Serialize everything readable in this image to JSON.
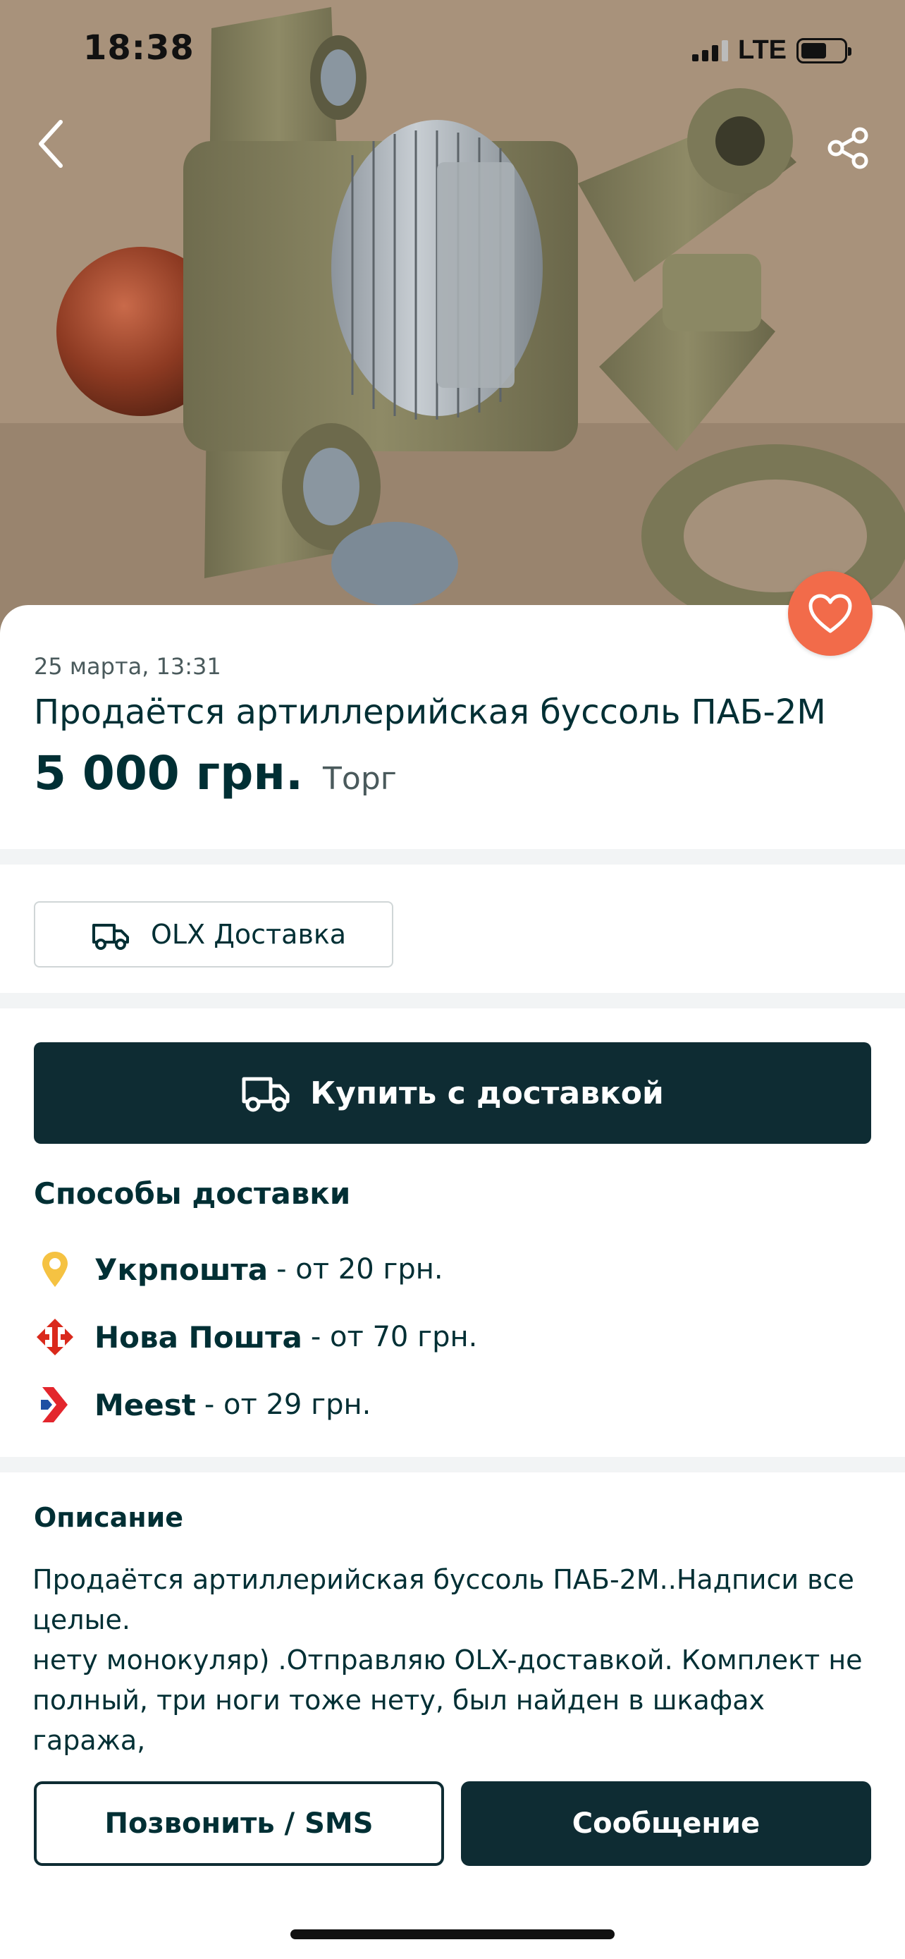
{
  "status_bar": {
    "time": "18:38",
    "network": "LTE",
    "battery_percent": 75
  },
  "nav": {
    "back_icon": "chevron-left-icon",
    "share_icon": "share-icon",
    "favorite_icon": "heart-icon"
  },
  "listing": {
    "date": "25 марта, 13:31",
    "title": "Продаётся артиллерийская буссоль ПАБ-2М",
    "price": "5 000 грн.",
    "negotiable": "Торг"
  },
  "olx_delivery": {
    "label": "OLX Доставка",
    "icon": "truck-icon"
  },
  "buy_button": {
    "label": "Купить с доставкой",
    "icon": "truck-icon"
  },
  "delivery": {
    "title": "Способы доставки",
    "items": [
      {
        "name": "Укрпошта",
        "note": "- от 20 грн.",
        "icon": "ukrposhta-pin-icon",
        "color": "#f5c242"
      },
      {
        "name": "Нова Пошта",
        "note": "- от 70 грн.",
        "icon": "nova-poshta-icon",
        "color": "#da291c"
      },
      {
        "name": "Meest",
        "note": "- от 29 грн.",
        "icon": "meest-icon",
        "color": "#e3262d"
      }
    ]
  },
  "description": {
    "title": "Описание",
    "text": "Продаётся артиллерийская буссоль ПАБ-2М..Надписи все\nцелые.\nнету монокуляр) .Отправляю OLX-доставкой. Комплект не\nполный, три ноги тоже нету, был найден в шкафах гаража,\nот куда хз.. Был найден ещё до начало войны и даже не"
  },
  "actions": {
    "call_label": "Позвонить / SMS",
    "message_label": "Сообщение"
  },
  "colors": {
    "primary_dark": "#0e2c33",
    "text": "#002f34",
    "favorite": "#f26b4a",
    "divider": "#f2f4f5"
  }
}
